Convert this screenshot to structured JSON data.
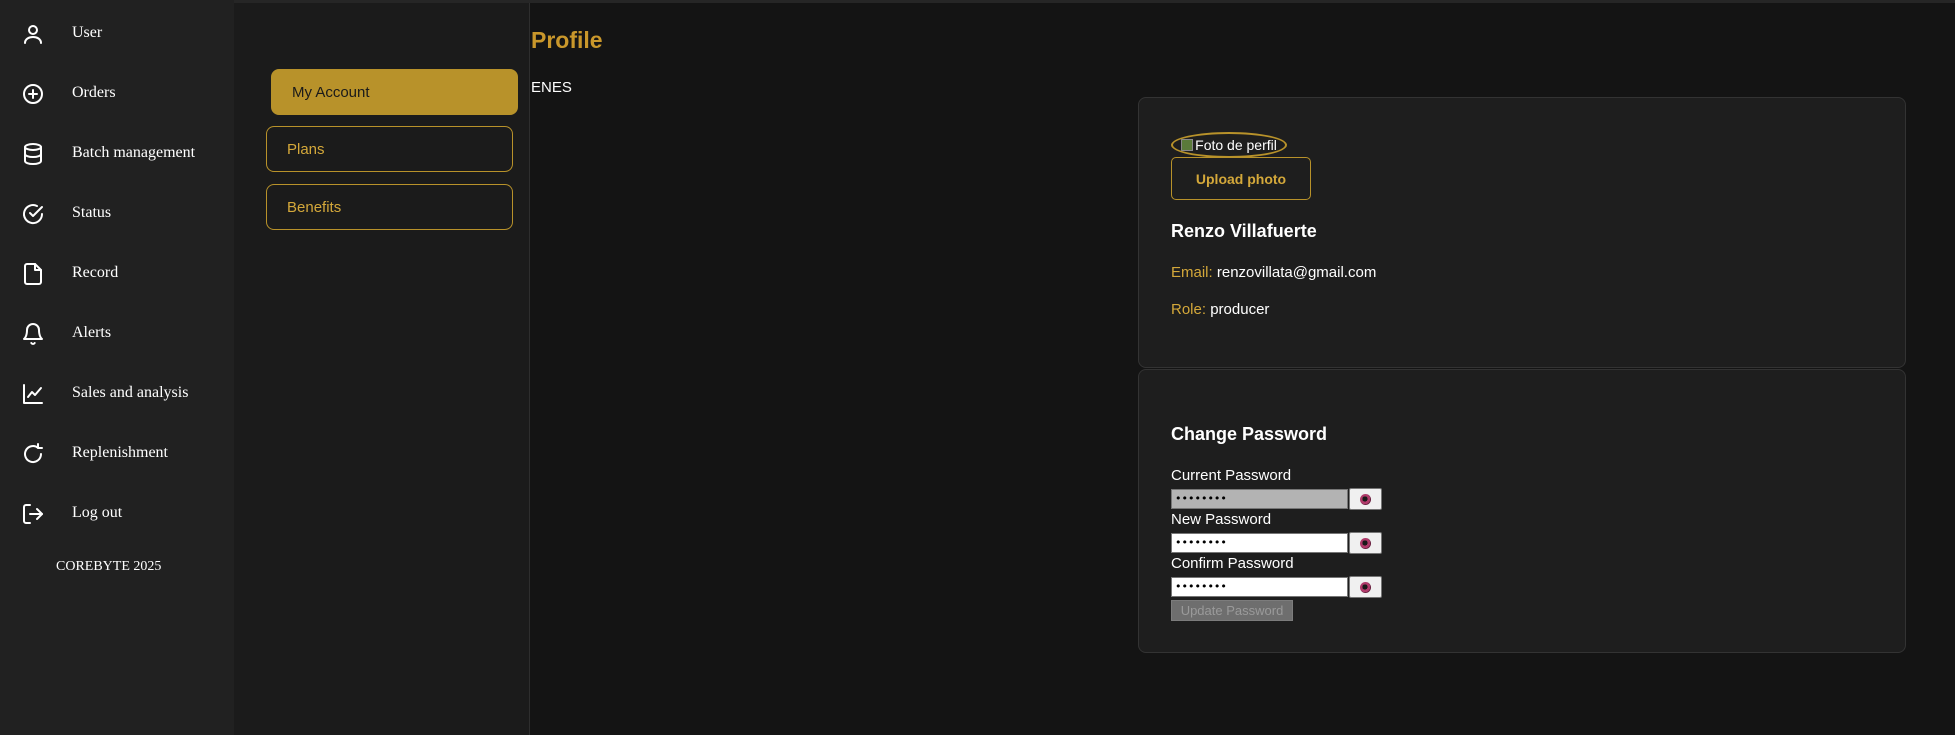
{
  "sidebar": {
    "items": [
      {
        "label": "User",
        "icon": "user-icon"
      },
      {
        "label": "Orders",
        "icon": "plus-circle-icon"
      },
      {
        "label": "Batch management",
        "icon": "database-icon"
      },
      {
        "label": "Status",
        "icon": "check-circle-icon"
      },
      {
        "label": "Record",
        "icon": "file-icon"
      },
      {
        "label": "Alerts",
        "icon": "bell-icon"
      },
      {
        "label": "Sales and analysis",
        "icon": "trending-up-icon"
      },
      {
        "label": "Replenishment",
        "icon": "refresh-icon"
      },
      {
        "label": "Log out",
        "icon": "logout-icon"
      }
    ],
    "footer": "COREBYTE 2025"
  },
  "profile_menu": {
    "items": [
      {
        "label": "My Account",
        "active": true
      },
      {
        "label": "Plans",
        "active": false
      },
      {
        "label": "Benefits",
        "active": false
      }
    ]
  },
  "header": {
    "title": "Profile",
    "language_toggle": "ENES"
  },
  "profile_card": {
    "avatar_alt": "Foto de perfil",
    "upload_label": "Upload photo",
    "name": "Renzo Villafuerte",
    "email_label": "Email:",
    "email": "renzovillata@gmail.com",
    "role_label": "Role:",
    "role": "producer"
  },
  "password_card": {
    "title": "Change Password",
    "current_label": "Current Password",
    "current_value": "••••••••",
    "new_label": "New Password",
    "new_value": "••••••••",
    "confirm_label": "Confirm Password",
    "confirm_value": "••••••••",
    "update_label": "Update Password"
  },
  "colors": {
    "accent": "#b8922a",
    "background": "#141414",
    "sidebar": "#212121",
    "card": "#1e1e1e"
  }
}
